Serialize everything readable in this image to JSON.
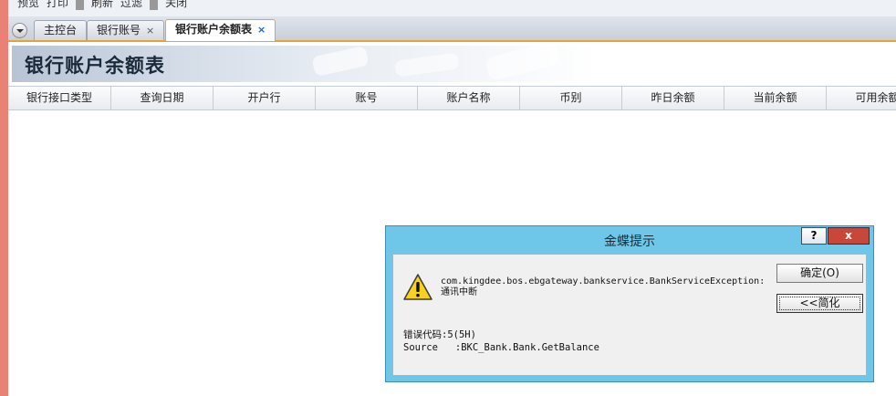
{
  "toolbar": {
    "items": [
      "预览",
      "打印",
      "刷新",
      "过滤",
      "关闭"
    ]
  },
  "tabs": {
    "items": [
      {
        "label": "主控台",
        "closable": false
      },
      {
        "label": "银行账号",
        "closable": true
      },
      {
        "label": "银行账户余额表",
        "closable": true,
        "active": true
      }
    ],
    "close_glyph": "×"
  },
  "page": {
    "title": "银行账户余额表"
  },
  "table": {
    "columns": [
      "银行接口类型",
      "查询日期",
      "开户行",
      "账号",
      "账户名称",
      "币别",
      "昨日余额",
      "当前余额",
      "可用余额"
    ],
    "rows": []
  },
  "dialog": {
    "title": "金蝶提示",
    "help_label": "?",
    "close_label": "x",
    "message_line1": "com.kingdee.bos.ebgateway.bankservice.BankServiceException:",
    "message_line2": "通讯中断",
    "error_code": "错误代码:5(5H)",
    "source": "Source   :BKC_Bank.Bank.GetBalance",
    "ok_label": "确定(O)",
    "simplify_label": "<<简化",
    "icon": "warning-icon"
  },
  "colors": {
    "left_strip": "#e98274",
    "tab_accent": "#e5a33a",
    "dialog_frame": "#6ec7e8",
    "close_button": "#c9473a"
  }
}
